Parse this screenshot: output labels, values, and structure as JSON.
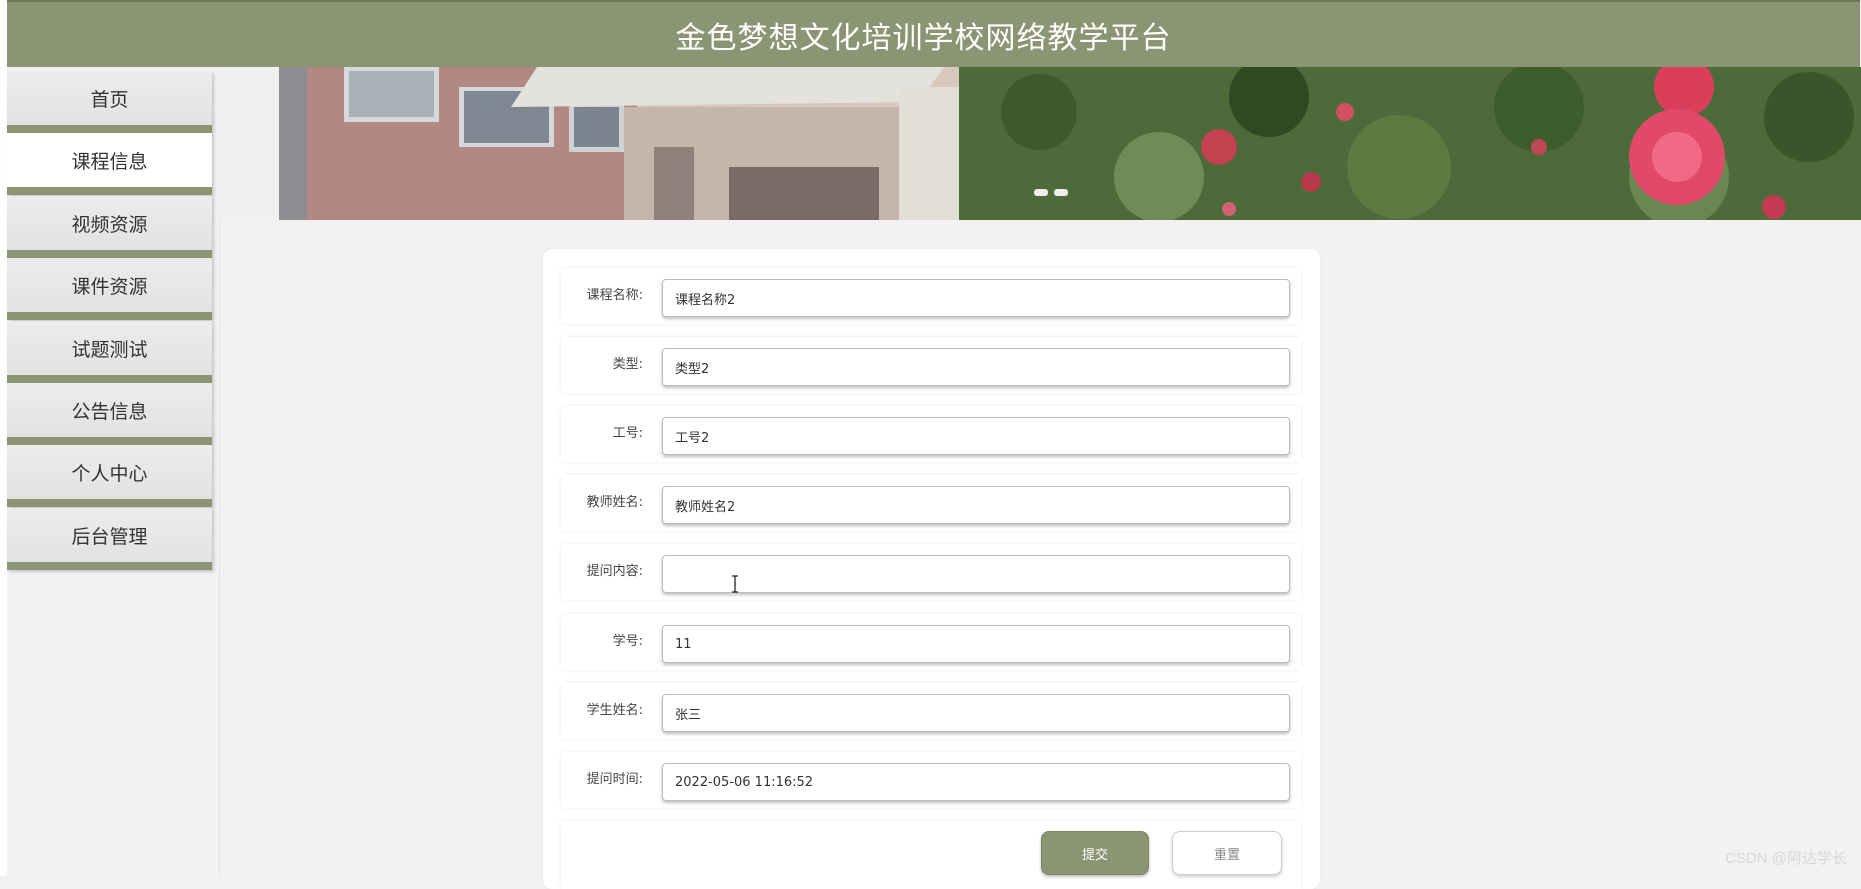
{
  "header": {
    "title": "金色梦想文化培训学校网络教学平台"
  },
  "sidebar": {
    "items": [
      {
        "label": "首页",
        "active": false
      },
      {
        "label": "课程信息",
        "active": true
      },
      {
        "label": "视频资源",
        "active": false
      },
      {
        "label": "课件资源",
        "active": false
      },
      {
        "label": "试题测试",
        "active": false
      },
      {
        "label": "公告信息",
        "active": false
      },
      {
        "label": "个人中心",
        "active": false
      },
      {
        "label": "后台管理",
        "active": false
      }
    ]
  },
  "form": {
    "fields": [
      {
        "label": "课程名称:",
        "value": "课程名称2"
      },
      {
        "label": "类型:",
        "value": "类型2"
      },
      {
        "label": "工号:",
        "value": "工号2"
      },
      {
        "label": "教师姓名:",
        "value": "教师姓名2"
      },
      {
        "label": "提问内容:",
        "value": ""
      },
      {
        "label": "学号:",
        "value": "11"
      },
      {
        "label": "学生姓名:",
        "value": "张三"
      },
      {
        "label": "提问时间:",
        "value": "2022-05-06 11:16:52"
      }
    ],
    "submit_label": "提交",
    "reset_label": "重置"
  },
  "watermark": "CSDN @阿达学长",
  "colors": {
    "accent": "#8c9573",
    "background": "#f2f2f2"
  }
}
